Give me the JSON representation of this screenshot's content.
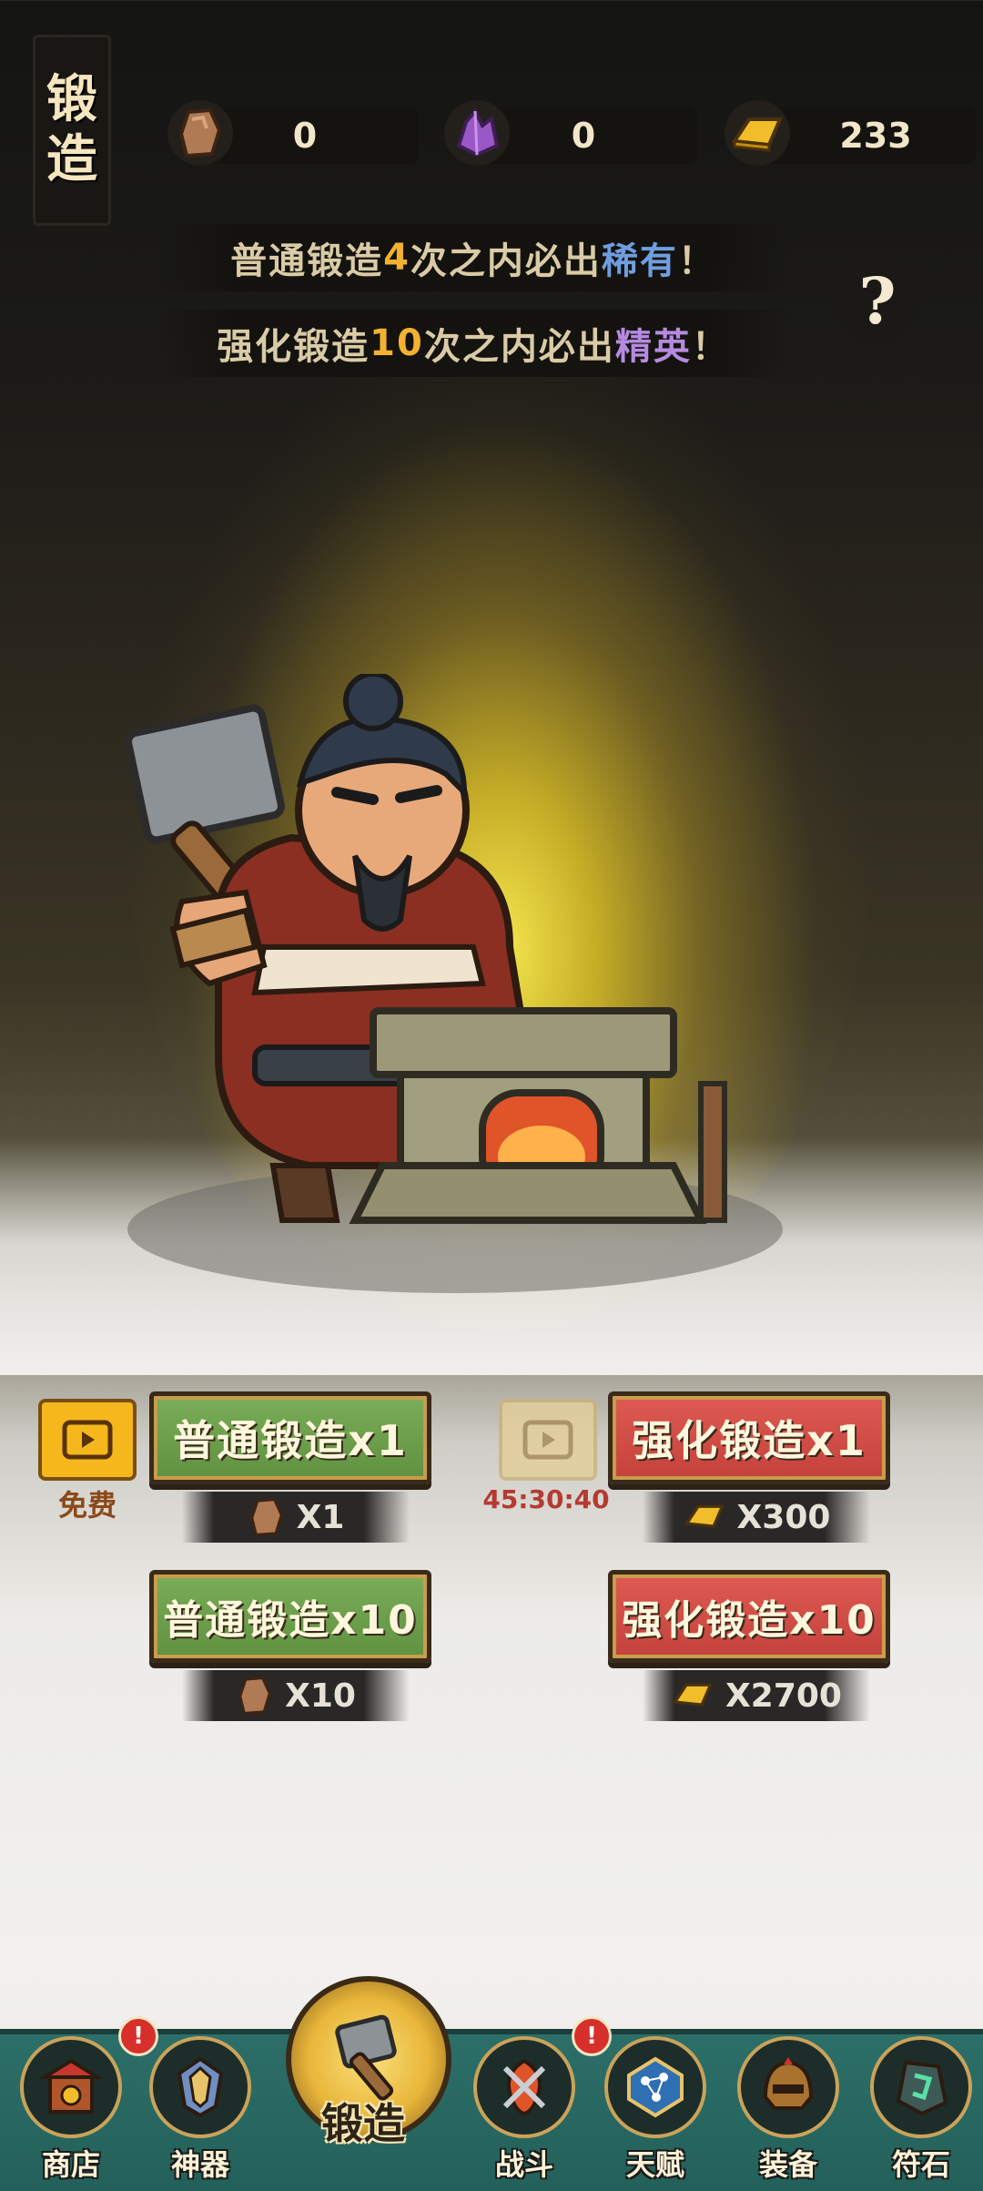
{
  "title": {
    "line1": "锻",
    "line2": "造"
  },
  "resources": [
    {
      "icon": "ore-stone-icon",
      "value": "0"
    },
    {
      "icon": "purple-crystal-icon",
      "value": "0"
    },
    {
      "icon": "gold-ingot-icon",
      "value": "233"
    }
  ],
  "banners": {
    "normal": {
      "prefix": "普通锻造",
      "count": "4",
      "middle": "次之内必出",
      "rarity": "稀有",
      "suffix": "！"
    },
    "enhanced": {
      "prefix": "强化锻造",
      "count": "10",
      "middle": "次之内必出",
      "rarity": "精英",
      "suffix": "！"
    }
  },
  "help_label": "?",
  "actions": {
    "free_ad_label": "免费",
    "ad_cooldown": "45:30:40",
    "normal_x1": {
      "label": "普通锻造x1",
      "cost": "X1"
    },
    "normal_x10": {
      "label": "普通锻造x10",
      "cost": "X10"
    },
    "enhanced_x1": {
      "label": "强化锻造x1",
      "cost": "X300"
    },
    "enhanced_x10": {
      "label": "强化锻造x10",
      "cost": "X2700"
    }
  },
  "nav": [
    {
      "label": "商店",
      "icon": "shop-icon",
      "badge": "!"
    },
    {
      "label": "神器",
      "icon": "artifact-icon"
    },
    {
      "label": "锻造",
      "icon": "hammer-icon",
      "active": true
    },
    {
      "label": "战斗",
      "icon": "battle-icon",
      "badge": "!"
    },
    {
      "label": "天赋",
      "icon": "talent-icon"
    },
    {
      "label": "装备",
      "icon": "helmet-icon"
    },
    {
      "label": "符石",
      "icon": "rune-stone-icon"
    }
  ],
  "colors": {
    "rare": "#6f9ee0",
    "elite": "#b58be0",
    "highlight": "#f2b22f",
    "normal_btn": "#6a9d4a",
    "enhanced_btn": "#d14f48"
  }
}
